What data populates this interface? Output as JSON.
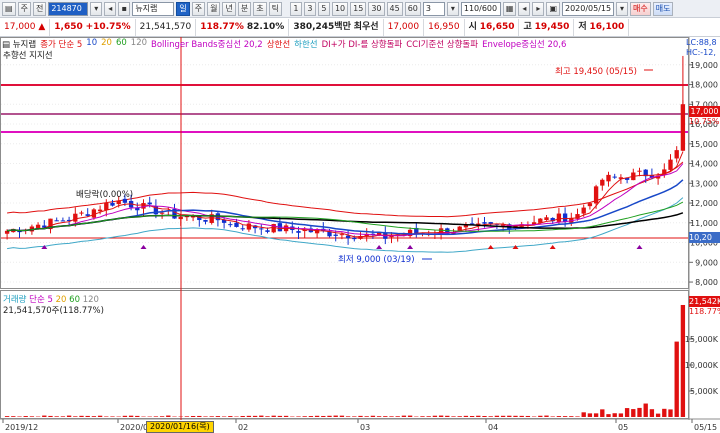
{
  "toolbar": {
    "stock_label": "주",
    "prev_label": "전",
    "code": "214870",
    "name": "뉴지랩",
    "buttons": [
      "일",
      "주",
      "월",
      "년",
      "분",
      "초",
      "틱"
    ],
    "intervals": [
      "1",
      "3",
      "5",
      "10",
      "15",
      "30",
      "45",
      "60",
      "3"
    ],
    "count": "110/600",
    "date": "2020/05/15",
    "buy_label": "매수",
    "sell_label": "매도"
  },
  "quote": {
    "price": "17,000 ▲",
    "change": "1,650",
    "change_pct": "+10.75%",
    "volume": "21,541,570",
    "vol_ratio": "118.77%",
    "turnover": "82.10%",
    "amount": "380,245백만",
    "best_ask_label": "최우선",
    "best_ask": "17,000",
    "best_bid": "16,950",
    "open_label": "시",
    "open": "16,650",
    "high_label": "고",
    "high": "19,450",
    "low_label": "저",
    "low": "16,100"
  },
  "legend": {
    "stock": "뉴지랩",
    "ma": "종가 단순 5",
    "ma10": "10",
    "ma20": "20",
    "ma60": "60",
    "ma120": "120",
    "bb": "Bollinger Bands중심선 20,2",
    "bb_up": "상한선",
    "bb_dn": "하한선",
    "dmi": "DI+가 DI-를 상향돌파",
    "cci": "CCI기준선 상향돌파",
    "env": "Envelope중심선 20,6",
    "line2": "추향선  지지선",
    "right": "LC:88,8",
    "right2": "HC:-12,"
  },
  "price_axis": [
    "19,000",
    "18,000",
    "17,000",
    "16,000",
    "15,000",
    "14,000",
    "13,000",
    "12,000",
    "11,000",
    "10,000",
    "9,000",
    "8,000"
  ],
  "price_tag": "17,000",
  "price_pct": "10.75%",
  "cur_tag": "10,20",
  "annotations": {
    "high": "최고 19,450 (05/15)",
    "low": "최저 9,000 (03/19)",
    "dividend": "배당락(0.00%)"
  },
  "volume": {
    "legend_label": "거래량",
    "legend_ma": "단순 5",
    "legend_20": "20",
    "legend_60": "60",
    "legend_120": "120",
    "value": "21,541,570주(118.77%)",
    "axis": [
      "15,000K",
      "10,000K",
      "5,000K"
    ],
    "tag": "21,542K",
    "pct": "118.77%"
  },
  "date_axis": [
    "2019/12",
    "2020/0",
    "02",
    "03",
    "04",
    "05",
    "05/15"
  ],
  "date_cursor": "2020/01/16(목)",
  "colors": {
    "up": "#e01010",
    "down": "#1030d0",
    "ma5": "#e01010",
    "ma20": "#1848c8",
    "ma60": "#000000",
    "bb": "#e01010",
    "env": "#c000c0"
  }
}
